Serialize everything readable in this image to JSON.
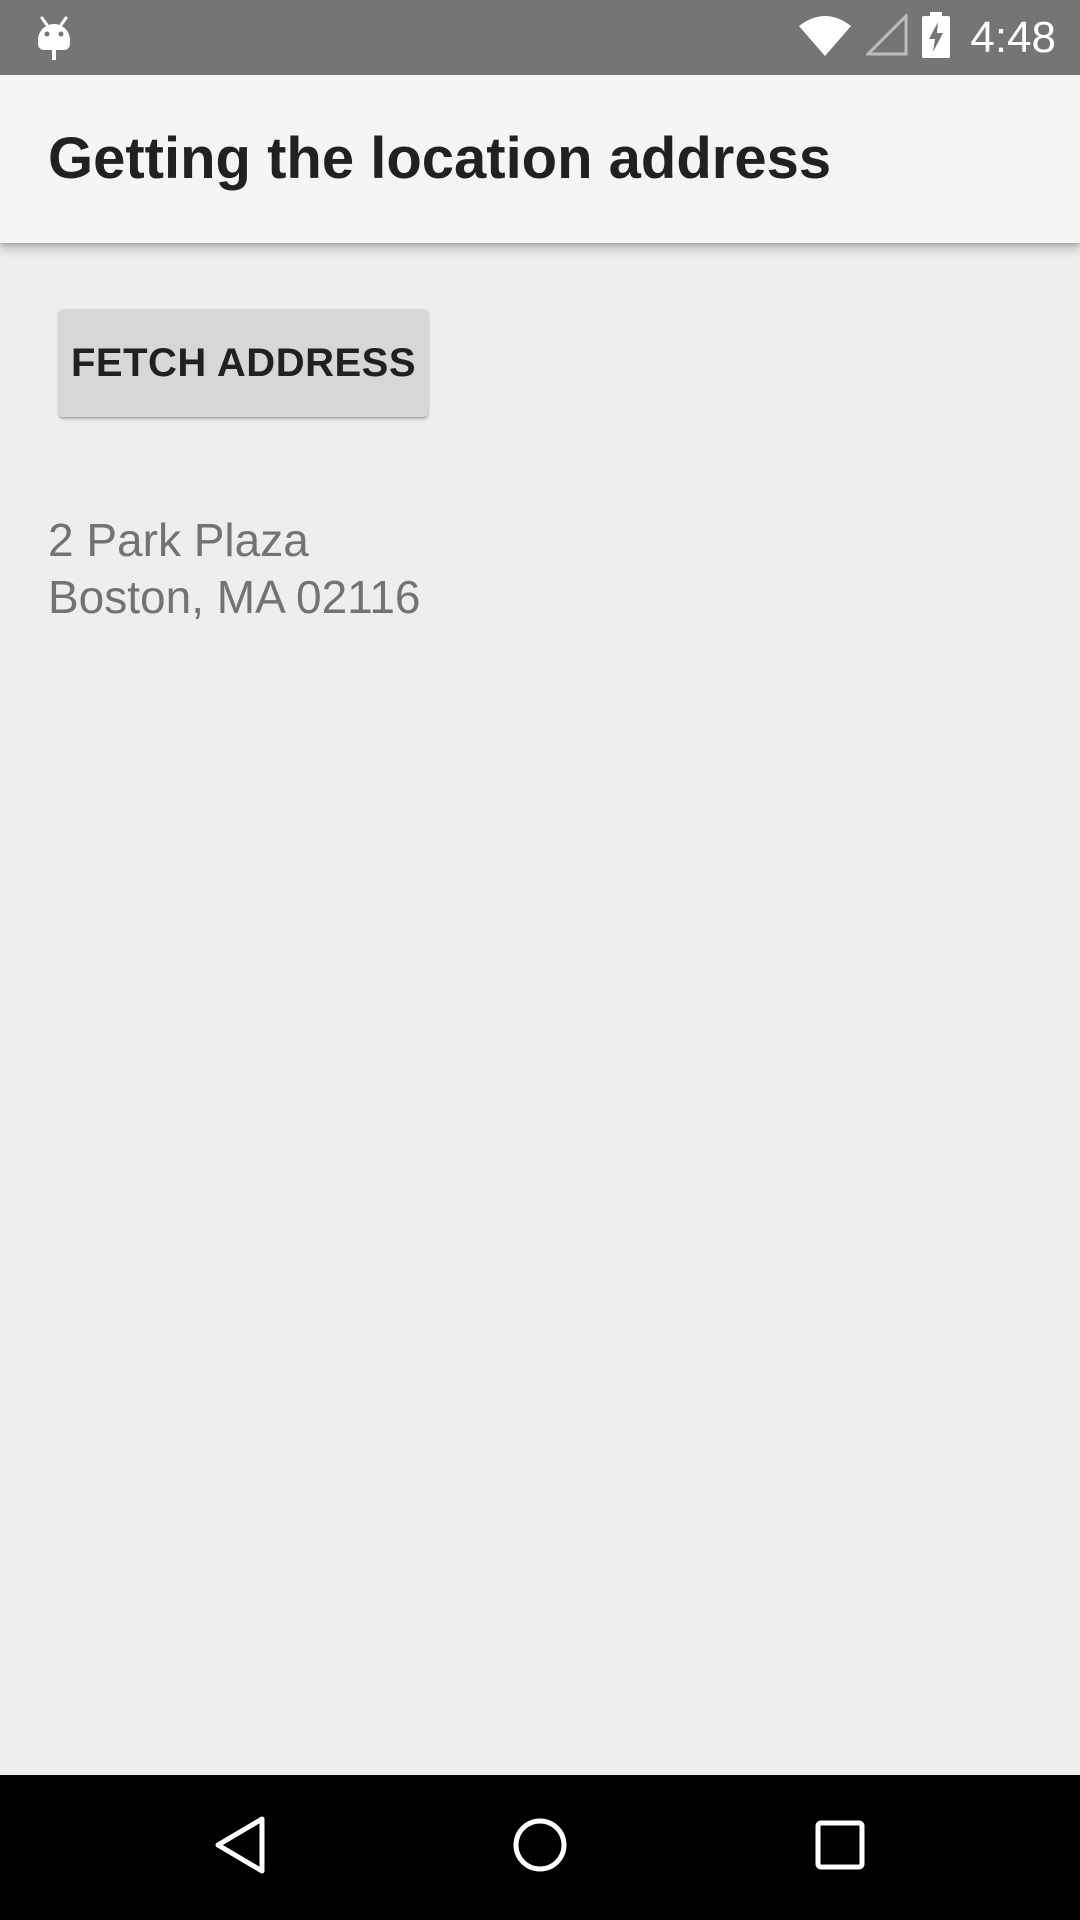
{
  "status_bar": {
    "time": "4:48",
    "icons": [
      "android-debug-icon",
      "wifi-icon",
      "cell-signal-icon",
      "battery-charging-icon"
    ]
  },
  "app_bar": {
    "title": "Getting the location address"
  },
  "main": {
    "fetch_button_label": "FETCH ADDRESS",
    "address_lines": [
      "2 Park Plaza",
      "Boston, MA 02116"
    ]
  },
  "nav_bar": {
    "icons": [
      "back-icon",
      "home-icon",
      "recents-icon"
    ]
  },
  "colors": {
    "status_bar": "#757575",
    "app_bar": "#f5f5f5",
    "background": "#eeeeee",
    "button": "#d6d7d7",
    "address_text": "#737373",
    "nav_bar": "#000000"
  }
}
